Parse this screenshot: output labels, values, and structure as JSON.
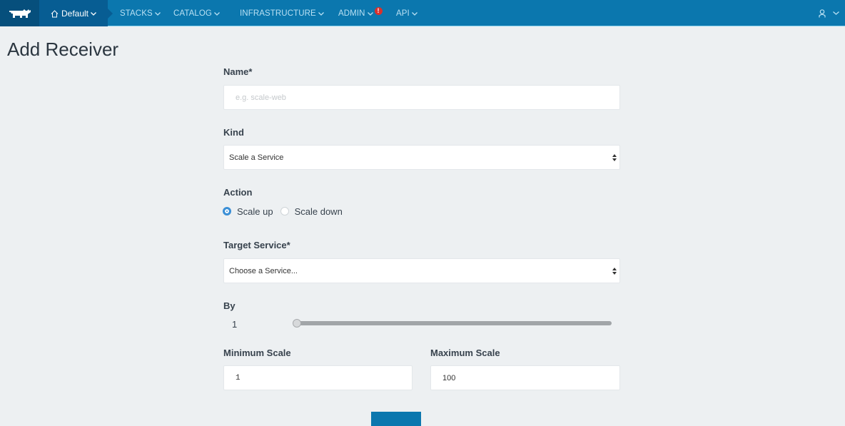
{
  "topbar": {
    "logo": "rancher-logo",
    "environment": {
      "label": "Default",
      "icon": "home-icon"
    },
    "nav": [
      {
        "label": "STACKS"
      },
      {
        "label": "CATALOG"
      },
      {
        "label": "INFRASTRUCTURE"
      },
      {
        "label": "ADMIN",
        "alert": "!"
      },
      {
        "label": "API"
      }
    ],
    "user_icon": "user-icon"
  },
  "page": {
    "title": "Add Receiver"
  },
  "form": {
    "name": {
      "label": "Name*",
      "value": "",
      "placeholder": "e.g. scale-web"
    },
    "kind": {
      "label": "Kind",
      "selected": "Scale a Service"
    },
    "action": {
      "label": "Action",
      "options": [
        {
          "label": "Scale up",
          "checked": true
        },
        {
          "label": "Scale down",
          "checked": false
        }
      ]
    },
    "target_service": {
      "label": "Target Service*",
      "selected": "Choose a Service..."
    },
    "by": {
      "label": "By",
      "value": "1",
      "slider_fraction": 0
    },
    "minimum_scale": {
      "label": "Minimum Scale",
      "value": "1"
    },
    "maximum_scale": {
      "label": "Maximum Scale",
      "value": "100"
    }
  },
  "colors": {
    "topbar": "#0b77ae",
    "logo_bg": "#064f7c",
    "env_bg": "#075d93",
    "page_bg": "#edf0f2",
    "radio_on": "#3b8fd6",
    "alert": "#d9302c"
  }
}
